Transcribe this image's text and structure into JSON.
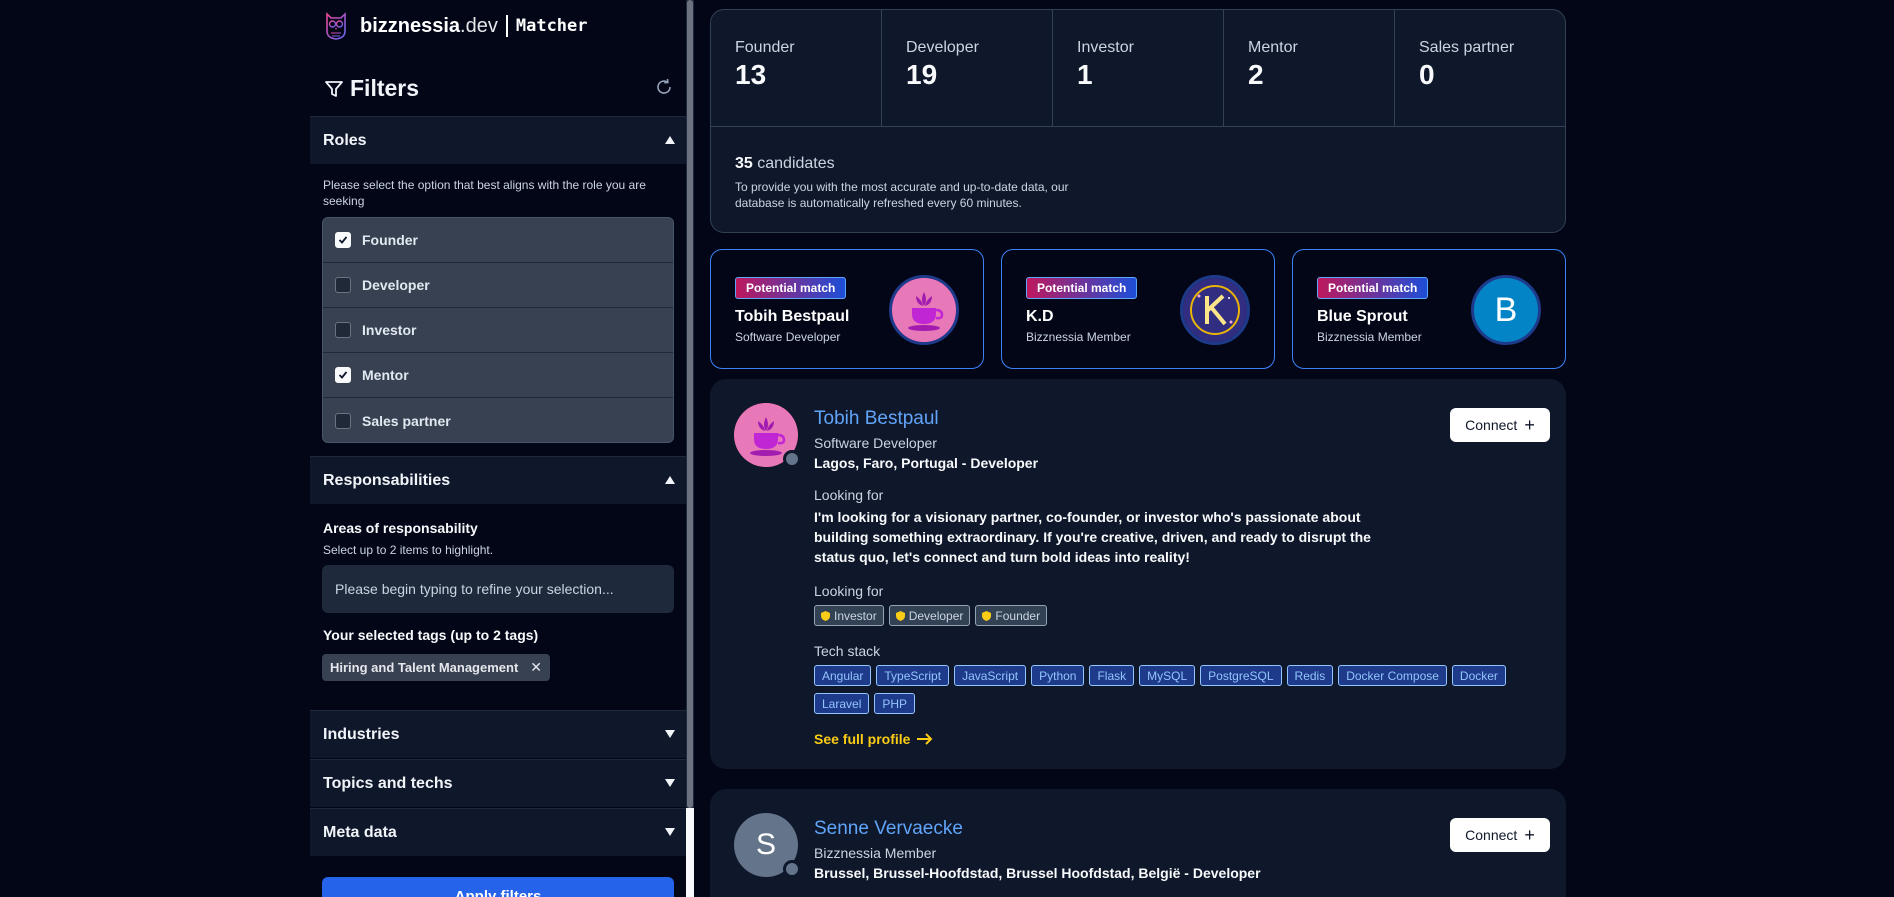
{
  "brand": {
    "name": "bizznessia",
    "tld": ".dev",
    "product": "Matcher"
  },
  "filters": {
    "title": "Filters",
    "roles": {
      "title": "Roles",
      "hint": "Please select the option that best aligns with the role you are seeking",
      "options": [
        {
          "label": "Founder",
          "checked": true
        },
        {
          "label": "Developer",
          "checked": false
        },
        {
          "label": "Investor",
          "checked": false
        },
        {
          "label": "Mentor",
          "checked": true
        },
        {
          "label": "Sales partner",
          "checked": false
        }
      ]
    },
    "responsabilities": {
      "title": "Responsabilities",
      "areas_label": "Areas of responsability",
      "areas_hint": "Select up to 2 items to highlight.",
      "input_placeholder": "Please begin typing to refine your selection...",
      "selected_label": "Your selected tags (up to 2 tags)",
      "selected_tags": [
        "Hiring and Talent Management"
      ]
    },
    "industries": "Industries",
    "topics": "Topics and techs",
    "meta": "Meta data",
    "apply": "Apply filters"
  },
  "stats": [
    {
      "label": "Founder",
      "value": "13"
    },
    {
      "label": "Developer",
      "value": "19"
    },
    {
      "label": "Investor",
      "value": "1"
    },
    {
      "label": "Mentor",
      "value": "2"
    },
    {
      "label": "Sales partner",
      "value": "0"
    }
  ],
  "candidates": {
    "count": "35",
    "word": "candidates",
    "note": "To provide you with the most accurate and up-to-date data, our database is automatically refreshed every 60 minutes."
  },
  "potential_matches": [
    {
      "badge": "Potential match",
      "name": "Tobih Bestpaul",
      "role": "Software Developer"
    },
    {
      "badge": "Potential match",
      "name": "K.D",
      "role": "Bizznessia Member"
    },
    {
      "badge": "Potential match",
      "name": "Blue Sprout",
      "role": "Bizznessia Member",
      "initial": "B"
    }
  ],
  "profiles": [
    {
      "name": "Tobih Bestpaul",
      "role": "Software Developer",
      "location": "Lagos, Faro, Portugal - Developer",
      "connect": "Connect",
      "looking_for_heading": "Looking for",
      "looking_for_text": "I'm looking for a visionary partner, co-founder, or investor who's passionate about building something extraordinary. If you're creative, driven, and ready to disrupt the status quo, let's connect and turn bold ideas into reality!",
      "looking_for_tags_heading": "Looking for",
      "looking_for_tags": [
        "Investor",
        "Developer",
        "Founder"
      ],
      "tech_heading": "Tech stack",
      "tech": [
        "Angular",
        "TypeScript",
        "JavaScript",
        "Python",
        "Flask",
        "MySQL",
        "PostgreSQL",
        "Redis",
        "Docker Compose",
        "Docker",
        "Laravel",
        "PHP"
      ],
      "full_profile": "See full profile"
    },
    {
      "name": "Senne Vervaecke",
      "role": "Bizznessia Member",
      "location": "Brussel, Brussel-Hoofdstad, Brussel Hoofdstad, België - Developer",
      "connect": "Connect",
      "initial": "S"
    }
  ]
}
